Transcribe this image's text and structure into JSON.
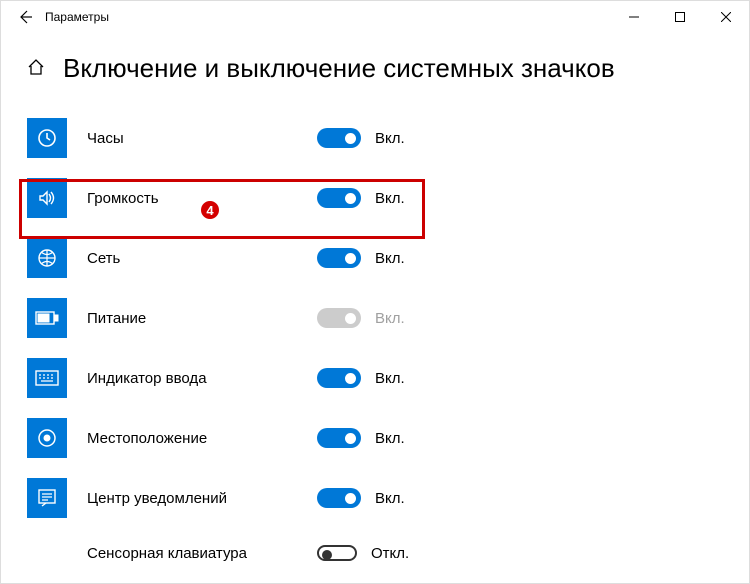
{
  "window": {
    "title": "Параметры"
  },
  "page": {
    "title": "Включение и выключение системных значков"
  },
  "state_labels": {
    "on": "Вкл.",
    "off": "Откл."
  },
  "items": [
    {
      "id": "clock",
      "label": "Часы",
      "on": true,
      "disabled": false
    },
    {
      "id": "volume",
      "label": "Громкость",
      "on": true,
      "disabled": false
    },
    {
      "id": "network",
      "label": "Сеть",
      "on": true,
      "disabled": false
    },
    {
      "id": "power",
      "label": "Питание",
      "on": true,
      "disabled": true
    },
    {
      "id": "input-indicator",
      "label": "Индикатор ввода",
      "on": true,
      "disabled": false
    },
    {
      "id": "location",
      "label": "Местоположение",
      "on": true,
      "disabled": false
    },
    {
      "id": "action-center",
      "label": "Центр уведомлений",
      "on": true,
      "disabled": false
    },
    {
      "id": "touch-keyboard",
      "label": "Сенсорная клавиатура",
      "on": false,
      "disabled": false
    }
  ],
  "annotation": {
    "badge": "4"
  }
}
